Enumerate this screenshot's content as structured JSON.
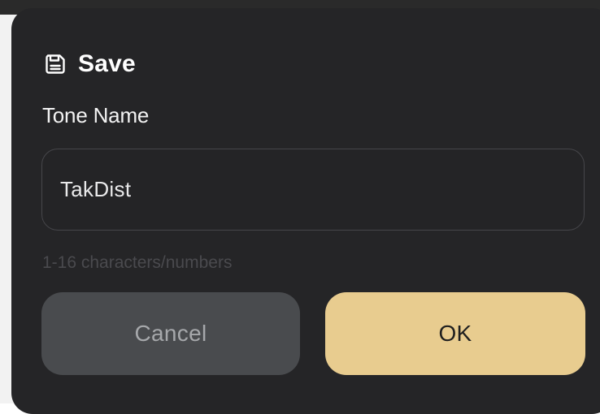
{
  "dialog": {
    "title": "Save",
    "title_icon": "save-icon",
    "field_label": "Tone Name",
    "input_value": "TakDist",
    "hint": "1-16 characters/numbers",
    "cancel_label": "Cancel",
    "ok_label": "OK"
  },
  "colors": {
    "dialog_bg": "#252527",
    "ok_bg": "#e8cc8f",
    "cancel_bg": "#494b4e",
    "input_border": "#46464a",
    "hint_text": "#4a4a4e"
  }
}
